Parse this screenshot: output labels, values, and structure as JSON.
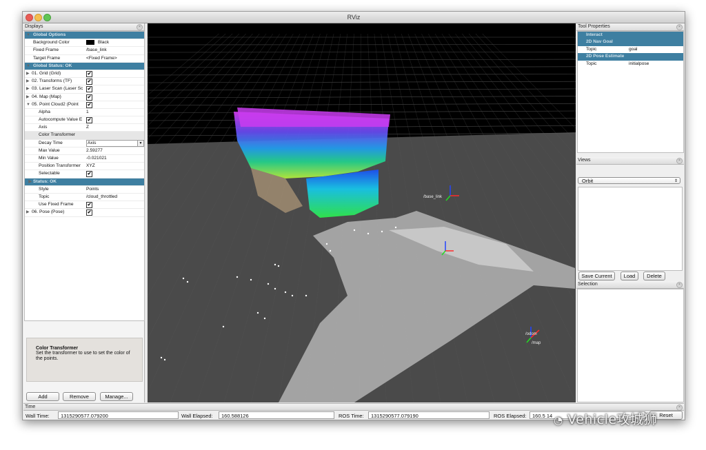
{
  "window": {
    "title": "RViz"
  },
  "displays": {
    "title": "Displays",
    "rows": [
      {
        "label": "Global Options",
        "type": "section"
      },
      {
        "label": "Background Color",
        "value": "Black",
        "swatch": "#000000",
        "type": "prop"
      },
      {
        "label": "Fixed Frame",
        "value": "/base_link",
        "type": "prop"
      },
      {
        "label": "Target Frame",
        "value": "<Fixed Frame>",
        "type": "prop"
      },
      {
        "label": "Global Status: OK",
        "type": "section"
      },
      {
        "label": "01. Grid (Grid)",
        "checked": true,
        "type": "display"
      },
      {
        "label": "02. Transforms (TF)",
        "checked": true,
        "type": "display"
      },
      {
        "label": "03. Laser Scan (Laser Sc",
        "checked": true,
        "type": "display"
      },
      {
        "label": "04. Map (Map)",
        "checked": true,
        "type": "display"
      },
      {
        "label": "05. Point Cloud2 (Point",
        "checked": true,
        "type": "display",
        "expanded": true
      },
      {
        "label": "Alpha",
        "value": "1",
        "type": "prop2"
      },
      {
        "label": "Autocompute Value E",
        "checked": true,
        "type": "prop2"
      },
      {
        "label": "Axis",
        "value": "Z",
        "type": "prop2"
      },
      {
        "label": "Color Transformer",
        "type": "group"
      },
      {
        "label": "Decay Time",
        "value": "Axis",
        "type": "combo"
      },
      {
        "label": "Max Value",
        "value": "2.59277",
        "type": "prop2"
      },
      {
        "label": "Min Value",
        "value": "-0.021021",
        "type": "prop2"
      },
      {
        "label": "Position Transformer",
        "value": "XYZ",
        "type": "prop2"
      },
      {
        "label": "Selectable",
        "checked": true,
        "type": "prop2"
      },
      {
        "label": "Status: OK",
        "type": "section2"
      },
      {
        "label": "Style",
        "value": "Points",
        "type": "prop2"
      },
      {
        "label": "Topic",
        "value": "/cloud_throttled",
        "type": "prop2"
      },
      {
        "label": "Use Fixed Frame",
        "checked": true,
        "type": "prop2"
      },
      {
        "label": "06. Pose (Pose)",
        "checked": true,
        "type": "display"
      }
    ],
    "description": {
      "title": "Color Transformer",
      "body": "Set the transformer to use to set the color of the points."
    },
    "buttons": {
      "add": "Add",
      "remove": "Remove",
      "manage": "Manage..."
    }
  },
  "tool_properties": {
    "title": "Tool Properties",
    "rows": [
      {
        "label": "Interact",
        "type": "section"
      },
      {
        "label": "2D Nav Goal",
        "type": "section"
      },
      {
        "label": "Topic",
        "value": "goal",
        "type": "prop"
      },
      {
        "label": "2D Pose Estimate",
        "type": "section"
      },
      {
        "label": "Topic",
        "value": "initialpose",
        "type": "prop"
      }
    ]
  },
  "views": {
    "title": "Views",
    "selected": "Orbit",
    "buttons": {
      "save": "Save Current",
      "load": "Load",
      "delete": "Delete"
    }
  },
  "selection": {
    "title": "Selection"
  },
  "scene": {
    "frame_labels": [
      "/base_link",
      "/odom",
      "/map"
    ]
  },
  "time": {
    "title": "Time",
    "wall_time_label": "Wall Time:",
    "wall_time": "1315290577.079200",
    "wall_elapsed_label": "Wall Elapsed:",
    "wall_elapsed": "160.588126",
    "ros_time_label": "ROS Time:",
    "ros_time": "1315290577.079190",
    "ros_elapsed_label": "ROS Elapsed:",
    "ros_elapsed": "160.5  14",
    "reset": "Reset"
  },
  "watermark": "Vehicle攻城狮",
  "colors": {
    "section_bg": "#3e7fa1",
    "viewport_bg": "#000000",
    "ground": "#4a4a4a"
  }
}
